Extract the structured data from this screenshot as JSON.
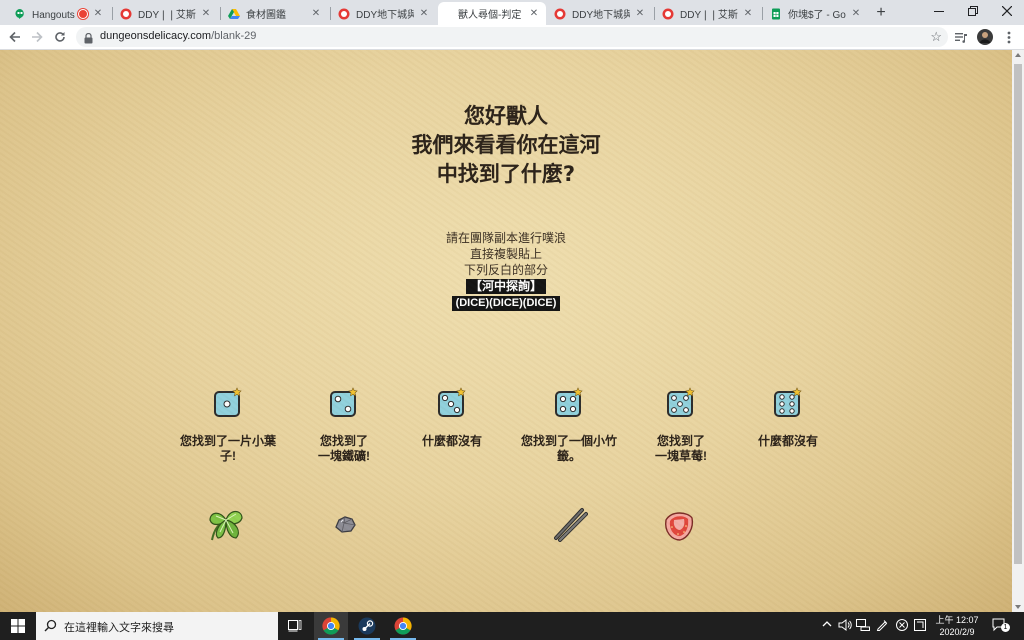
{
  "browser": {
    "tabs": [
      {
        "title": "Hangouts 影",
        "icon": "hangouts-icon",
        "recording": true,
        "active": false
      },
      {
        "title": "DDY❘❘艾斯·艾麗",
        "icon": "ddy-site-icon",
        "active": false
      },
      {
        "title": "食材圖鑑",
        "icon": "google-drive-icon",
        "active": false
      },
      {
        "title": "DDY地下城與美",
        "icon": "ddy-site-icon",
        "active": false
      },
      {
        "title": "獸人尋個-判定",
        "icon": "none",
        "active": true
      },
      {
        "title": "DDY地下城與美",
        "icon": "ddy-site-icon",
        "active": false
      },
      {
        "title": "DDY❘❘艾斯·艾麗",
        "icon": "ddy-site-icon",
        "active": false
      },
      {
        "title": "你塊$了 - Goog",
        "icon": "google-sheets-icon",
        "active": false
      }
    ],
    "url_host": "dungeonsdelicacy.com",
    "url_path": "/blank-29"
  },
  "page": {
    "heading": [
      "您好獸人",
      "我們來看看你在這河",
      "中找到了什麼?"
    ],
    "instructions": [
      "請在團隊副本進行噗浪",
      "直接複製貼上",
      "下列反白的部分"
    ],
    "highlight_title": "【河中探詢】",
    "highlight_dice": "(DICE)(DICE)(DICE)",
    "results": [
      {
        "die": 1,
        "text": "您找到了一片小葉子!",
        "item": "mint-leaf"
      },
      {
        "die": 2,
        "text": "您找到了一塊鐵礦!",
        "item": "iron-ore"
      },
      {
        "die": 3,
        "text": "什麼都沒有",
        "item": "none"
      },
      {
        "die": 4,
        "text": "您找到了一個小竹籤。",
        "item": "bamboo-skewers"
      },
      {
        "die": 5,
        "text": "您找到了一塊草莓!",
        "item": "strawberry"
      },
      {
        "die": 6,
        "text": "什麼都沒有",
        "item": "none"
      }
    ],
    "result_lines": [
      [
        "您找到了一片小葉",
        "子!"
      ],
      [
        "您找到了",
        "一塊鐵礦!"
      ],
      [
        "什麼都沒有"
      ],
      [
        "您找到了一個小竹",
        "籤。"
      ],
      [
        "您找到了",
        "一塊草莓!"
      ],
      [
        "什麼都沒有"
      ]
    ]
  },
  "taskbar": {
    "search_placeholder": "在這裡輸入文字來搜尋",
    "time": "上午 12:07",
    "date": "2020/2/9",
    "notifications": "1"
  },
  "colors": {
    "die_face": "#8fd0dc",
    "die_border": "#2a2a2a",
    "heading": "#2a2118",
    "parchment": "#e8d39f"
  }
}
